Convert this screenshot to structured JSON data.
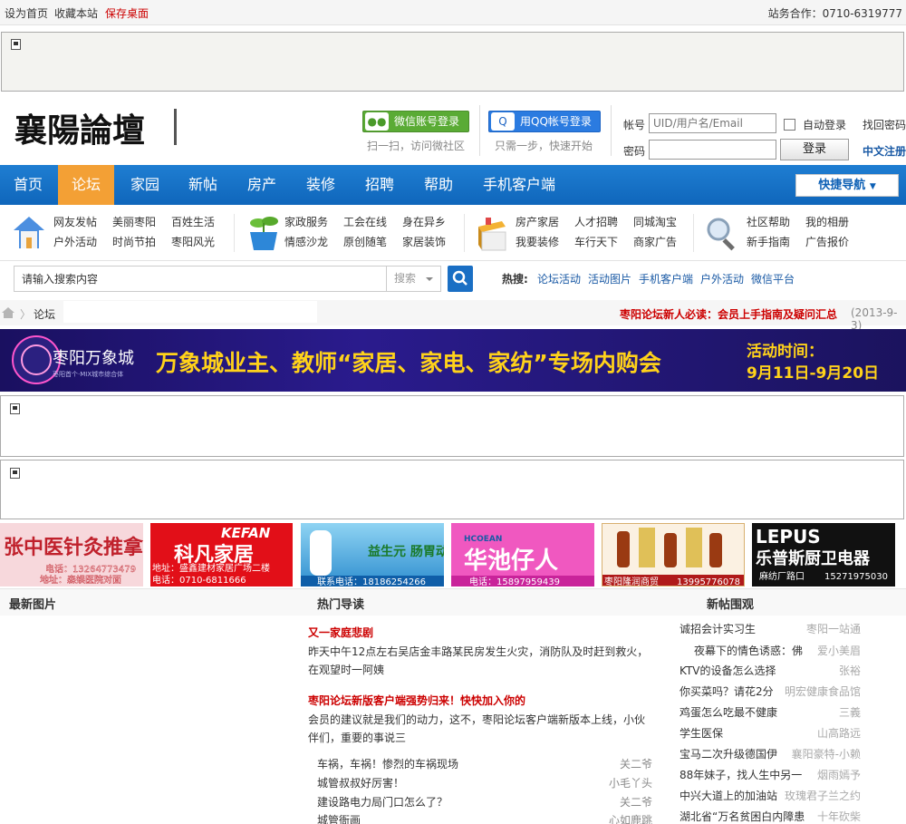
{
  "topbar": {
    "set_home": "设为首页",
    "bookmark": "收藏本站",
    "save_desktop": "保存桌面",
    "cooperation": "站务合作：0710-6319777"
  },
  "header": {
    "logo_text": "襄陽論壇",
    "wechat_login": "微信账号登录",
    "wechat_sub": "扫一扫，访问微社区",
    "qq_login": "用QQ帐号登录",
    "qq_sub": "只需一步，快速开始",
    "account_label": "帐号",
    "account_placeholder": "UID/用户名/Email",
    "password_label": "密码",
    "auto_login": "自动登录",
    "find_password": "找回密码",
    "login_button": "登录",
    "register": "中文注册"
  },
  "nav": {
    "items": [
      "首页",
      "论坛",
      "家园",
      "新帖",
      "房产",
      "装修",
      "招聘",
      "帮助",
      "手机客户端"
    ],
    "active": "论坛",
    "quick_nav": "快捷导航"
  },
  "subnav": {
    "groups": [
      {
        "icon": "house-icon",
        "links": [
          "网友发帖",
          "美丽枣阳",
          "百姓生活",
          "户外活动",
          "时尚节拍",
          "枣阳风光"
        ]
      },
      {
        "icon": "plant-icon",
        "links": [
          "家政服务",
          "工会在线",
          "身在异乡",
          "情感沙龙",
          "原创随笔",
          "家居装饰"
        ]
      },
      {
        "icon": "box-icon",
        "links": [
          "房产家居",
          "人才招聘",
          "同城淘宝",
          "我要装修",
          "车行天下",
          "商家广告"
        ]
      },
      {
        "icon": "magnifier-icon",
        "links": [
          "社区帮助",
          "我的相册",
          "新手指南",
          "广告报价"
        ]
      }
    ]
  },
  "search": {
    "placeholder": "请输入搜索内容",
    "type": "搜索",
    "hot_label": "热搜:",
    "hot_links": [
      "论坛活动",
      "活动图片",
      "手机客户端",
      "户外活动",
      "微信平台"
    ]
  },
  "breadcrumb": {
    "current": "论坛",
    "announcement": "枣阳论坛新人必读：会员上手指南及疑问汇总",
    "announcement_date": "(2013-9-3)"
  },
  "banner": {
    "brand": "枣阳万象城",
    "brand_sub": "枣阳首个·MIX城市综合体",
    "headline": "万象城业主、教师“家居、家电、家纺”专场内购会",
    "time_label": "活动时间：",
    "time_range": "9月11日-9月20日"
  },
  "ads": [
    {
      "title": "张中医针灸推拿",
      "line1": "电话：13264773479",
      "line2": "地址：森娱医院对面"
    },
    {
      "brand": "KEFAN",
      "title": "科凡家居",
      "line1": "地址：盛鑫建材家居广场二楼",
      "line2": "电话：0710-6811666"
    },
    {
      "title": "益生元 肠胃动力源",
      "line1": "联系电话：18186254266"
    },
    {
      "brand": "HCOEAN",
      "title": "华池仔人",
      "line1": "电话：15897959439"
    },
    {
      "title": "枣阳隆润商贸",
      "line1": "13995776078"
    },
    {
      "brand": "LEPUS",
      "title": "乐普斯厨卫电器",
      "line1": "麻纺厂路口",
      "line2": "15271975030"
    }
  ],
  "bottom": {
    "latest_images": "最新图片",
    "hot_guide": "热门导读",
    "new_posts": "新帖围观",
    "headline1": "又一家庭悲剧",
    "para1": "昨天中午12点左右吴店金丰路某民房发生火灾，消防队及时赶到救火，在观望时一阿姨",
    "headline2": "枣阳论坛新版客户端强势归来！快快加入你的",
    "para2": "会员的建议就是我们的动力，这不，枣阳论坛客户端新版本上线，小伙伴们，重要的事说三",
    "hot_list": [
      {
        "title": "车祸，车祸！惨烈的车祸现场",
        "author": "关二爷"
      },
      {
        "title": "城管叔叔好厉害！",
        "author": "小毛丫头"
      },
      {
        "title": "建设路电力局门口怎么了？",
        "author": "关二爷"
      },
      {
        "title": "城管衙画",
        "author": "心如鹿跳"
      }
    ],
    "new_list": [
      {
        "title": "诚招会计实习生",
        "author": "枣阳一站通"
      },
      {
        "title": "夜幕下的情色诱惑：佛",
        "author": "爱小美眉"
      },
      {
        "title": "KTV的设备怎么选择",
        "author": "张裕"
      },
      {
        "title": "你买菜吗？请花2分",
        "author": "明宏健康食品馆"
      },
      {
        "title": "鸡蛋怎么吃最不健康",
        "author": "三義"
      },
      {
        "title": "学生医保",
        "author": "山高路远"
      },
      {
        "title": "宝马二次升级德国伊",
        "author": "襄阳豪特-小赖"
      },
      {
        "title": "88年妹子，找人生中另一",
        "author": "烟雨嫣予"
      },
      {
        "title": "中兴大道上的加油站",
        "author": "玫瑰君子兰之约"
      },
      {
        "title": "湖北省“万名贫困白内障患",
        "author": "十年砍柴"
      }
    ]
  }
}
